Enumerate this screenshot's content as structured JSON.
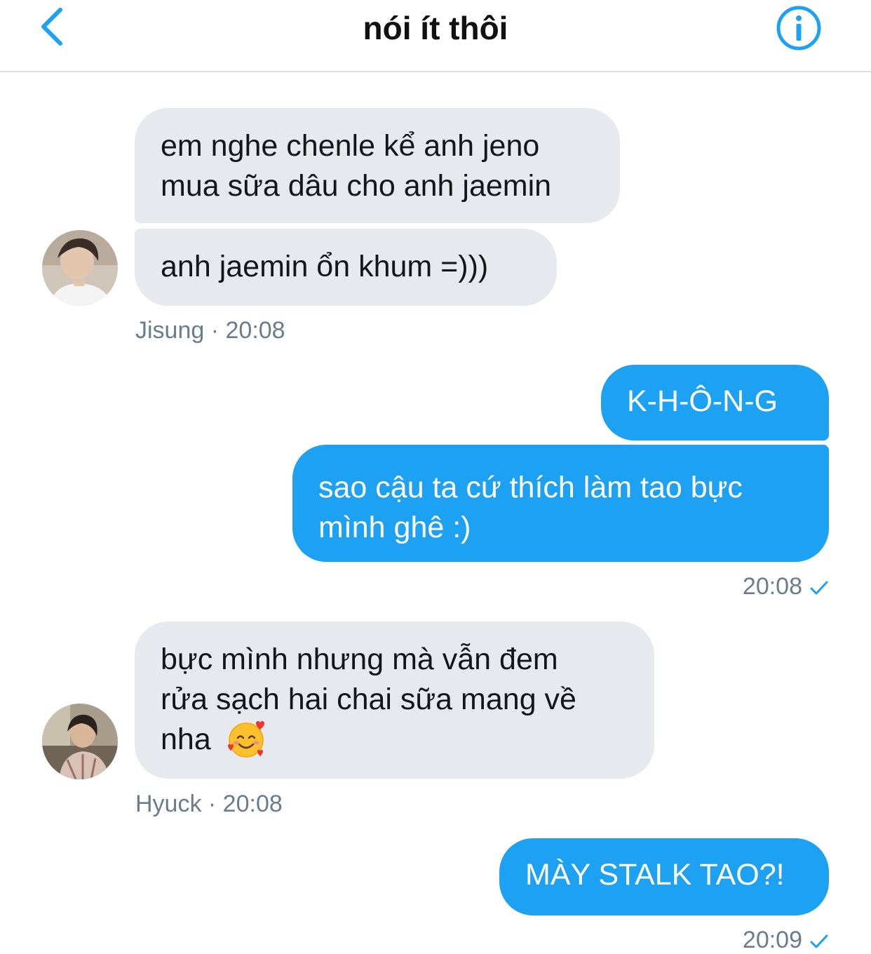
{
  "header": {
    "title": "nói ít thôi"
  },
  "messages": [
    {
      "side": "received",
      "sender": "Jisung",
      "bubbles": [
        {
          "lines": [
            "em nghe chenle kể anh jeno",
            "mua sữa dâu cho anh jaemin"
          ]
        },
        {
          "lines": [
            "anh jaemin ổn khum =)))"
          ]
        }
      ],
      "time": "20:08",
      "meta": "Jisung · 20:08"
    },
    {
      "side": "sent",
      "bubbles": [
        {
          "lines": [
            "K-H-Ô-N-G"
          ]
        },
        {
          "lines": [
            "sao cậu ta cứ thích làm tao bực",
            "mình ghê :)"
          ]
        }
      ],
      "time": "20:08"
    },
    {
      "side": "received",
      "sender": "Hyuck",
      "bubbles": [
        {
          "lines": [
            "bực mình nhưng mà vẫn đem",
            "rửa sạch hai chai sữa mang về",
            "nha"
          ]
        }
      ],
      "time": "20:08",
      "meta": "Hyuck · 20:08"
    },
    {
      "side": "sent",
      "bubbles": [
        {
          "lines": [
            "MÀY STALK TAO?!"
          ]
        }
      ],
      "time": "20:09"
    }
  ],
  "icons": {
    "back": "chevron-left-icon",
    "info": "info-circle-icon",
    "read_receipt": "checkmark-icon",
    "emoji": "smiling-face-with-hearts-icon"
  },
  "colors": {
    "accent": "#1da1f2",
    "received_bubble": "#e6e9ee",
    "meta_text": "#6b7c8c"
  }
}
